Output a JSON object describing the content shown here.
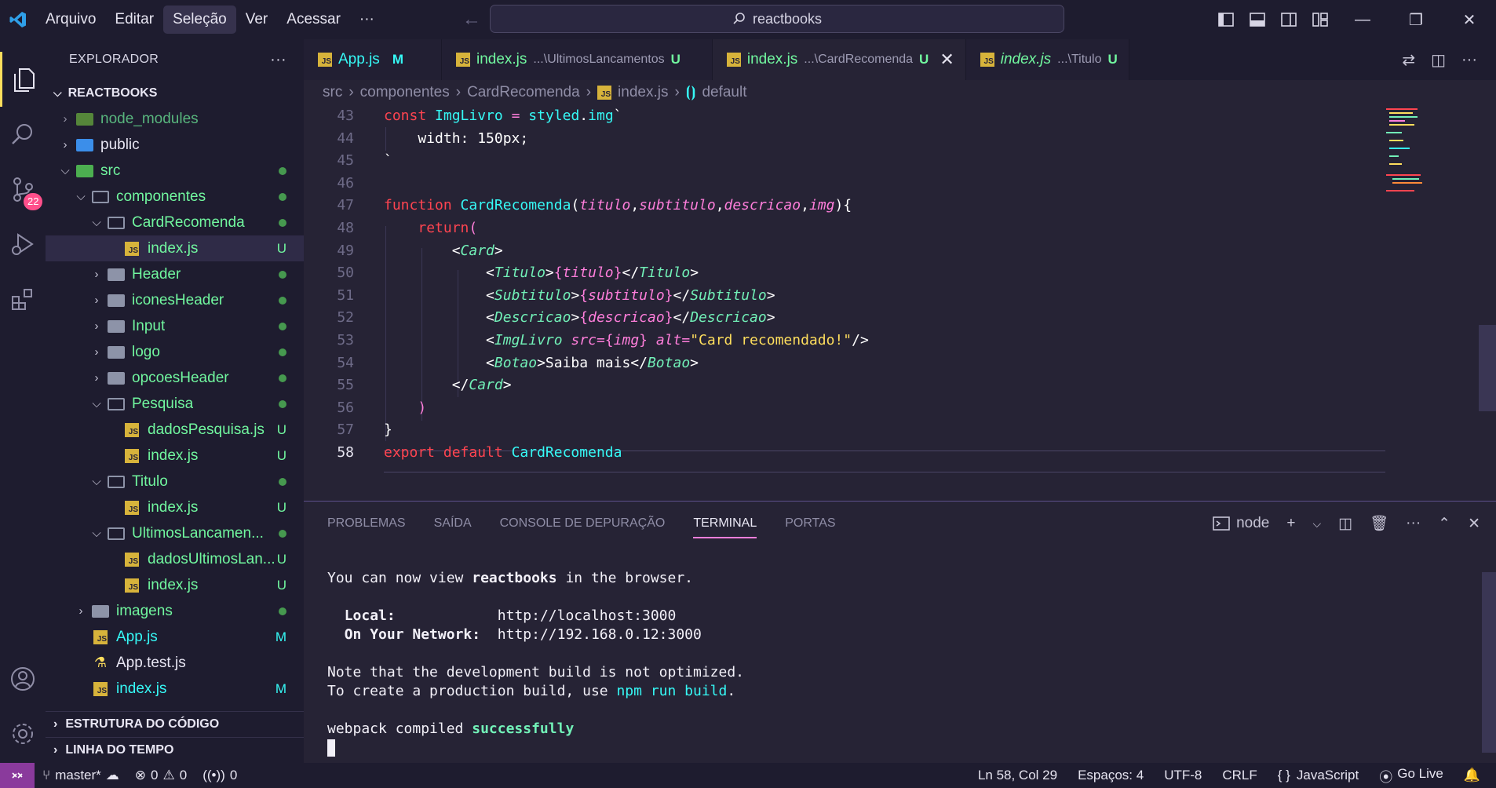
{
  "menu": [
    "Arquivo",
    "Editar",
    "Seleção",
    "Ver",
    "Acessar"
  ],
  "menu_active": "Seleção",
  "search": {
    "text": "reactbooks"
  },
  "sidebar": {
    "title": "EXPLORADOR",
    "root": "REACTBOOKS",
    "tree": [
      {
        "label": "node_modules",
        "kind": "folder-node",
        "depth": 1,
        "expanded": false,
        "color": "#71f79f",
        "dim": true,
        "status": ""
      },
      {
        "label": "public",
        "kind": "folder-public",
        "depth": 1,
        "expanded": false,
        "color": "#e8e6f3",
        "status": ""
      },
      {
        "label": "src",
        "kind": "folder-src",
        "depth": 1,
        "expanded": true,
        "color": "#71f79f",
        "status": "dot"
      },
      {
        "label": "componentes",
        "kind": "folder",
        "depth": 2,
        "expanded": true,
        "color": "#71f79f",
        "status": "dot"
      },
      {
        "label": "CardRecomenda",
        "kind": "folder",
        "depth": 3,
        "expanded": true,
        "color": "#71f79f",
        "status": "dot"
      },
      {
        "label": "index.js",
        "kind": "js",
        "depth": 4,
        "color": "#71f79f",
        "status": "U",
        "selected": true
      },
      {
        "label": "Header",
        "kind": "folder",
        "depth": 3,
        "expanded": false,
        "color": "#71f79f",
        "status": "dot"
      },
      {
        "label": "iconesHeader",
        "kind": "folder",
        "depth": 3,
        "expanded": false,
        "color": "#71f79f",
        "status": "dot"
      },
      {
        "label": "Input",
        "kind": "folder",
        "depth": 3,
        "expanded": false,
        "color": "#71f79f",
        "status": "dot"
      },
      {
        "label": "logo",
        "kind": "folder",
        "depth": 3,
        "expanded": false,
        "color": "#71f79f",
        "status": "dot"
      },
      {
        "label": "opcoesHeader",
        "kind": "folder",
        "depth": 3,
        "expanded": false,
        "color": "#71f79f",
        "status": "dot"
      },
      {
        "label": "Pesquisa",
        "kind": "folder",
        "depth": 3,
        "expanded": true,
        "color": "#71f79f",
        "status": "dot"
      },
      {
        "label": "dadosPesquisa.js",
        "kind": "js",
        "depth": 4,
        "color": "#71f79f",
        "status": "U"
      },
      {
        "label": "index.js",
        "kind": "js",
        "depth": 4,
        "color": "#71f79f",
        "status": "U"
      },
      {
        "label": "Titulo",
        "kind": "folder",
        "depth": 3,
        "expanded": true,
        "color": "#71f79f",
        "status": "dot"
      },
      {
        "label": "index.js",
        "kind": "js",
        "depth": 4,
        "color": "#71f79f",
        "status": "U"
      },
      {
        "label": "UltimosLancamen...",
        "kind": "folder",
        "depth": 3,
        "expanded": true,
        "color": "#71f79f",
        "status": "dot"
      },
      {
        "label": "dadosUltimosLan...",
        "kind": "js",
        "depth": 4,
        "color": "#71f79f",
        "status": "U"
      },
      {
        "label": "index.js",
        "kind": "js",
        "depth": 4,
        "color": "#71f79f",
        "status": "U"
      },
      {
        "label": "imagens",
        "kind": "folder",
        "depth": 2,
        "expanded": false,
        "color": "#71f79f",
        "status": "dot"
      },
      {
        "label": "App.js",
        "kind": "js",
        "depth": 2,
        "color": "#36f9f6",
        "status": "M"
      },
      {
        "label": "App.test.js",
        "kind": "test",
        "depth": 2,
        "color": "#e8e6f3",
        "status": ""
      },
      {
        "label": "index.js",
        "kind": "js",
        "depth": 2,
        "color": "#36f9f6",
        "status": "M"
      }
    ],
    "sections": [
      "ESTRUTURA DO CÓDIGO",
      "LINHA DO TEMPO"
    ]
  },
  "scm_badge": "22",
  "tabs": [
    {
      "name": "App.js",
      "desc": "",
      "status": "M",
      "color": "#36f9f6",
      "active": false,
      "preview": false
    },
    {
      "name": "index.js",
      "desc": "...\\UltimosLancamentos",
      "status": "U",
      "color": "#71f79f",
      "active": false,
      "preview": false
    },
    {
      "name": "index.js",
      "desc": "...\\CardRecomenda",
      "status": "U",
      "color": "#71f79f",
      "active": true,
      "preview": false
    },
    {
      "name": "index.js",
      "desc": "...\\Titulo",
      "status": "U",
      "color": "#71f79f",
      "active": false,
      "preview": true
    }
  ],
  "breadcrumb": [
    "src",
    "componentes",
    "CardRecomenda",
    "index.js",
    "default"
  ],
  "editor": {
    "current_line": 58
  },
  "panel": {
    "tabs": [
      "PROBLEMAS",
      "SAÍDA",
      "CONSOLE DE DEPURAÇÃO",
      "TERMINAL",
      "PORTAS"
    ],
    "active_tab": "TERMINAL",
    "shell": "node",
    "terminal": {
      "l1a": "You can now view ",
      "l1b": "reactbooks",
      "l1c": " in the browser.",
      "local_label": "Local:",
      "local_url": "http://localhost:3000",
      "net_label": "On Your Network:",
      "net_url": "http://192.168.0.12:3000",
      "note1": "Note that the development build is not optimized.",
      "note2a": "To create a production build, use ",
      "note2b": "npm run build",
      "note2c": ".",
      "wp_a": "webpack compiled ",
      "wp_b": "successfully"
    }
  },
  "status": {
    "branch": "master*",
    "errors": "0",
    "warnings": "0",
    "ports": "0",
    "position": "Ln 58, Col 29",
    "spaces": "Espaços: 4",
    "encoding": "UTF-8",
    "eol": "CRLF",
    "language": "JavaScript",
    "golive": "Go Live"
  }
}
